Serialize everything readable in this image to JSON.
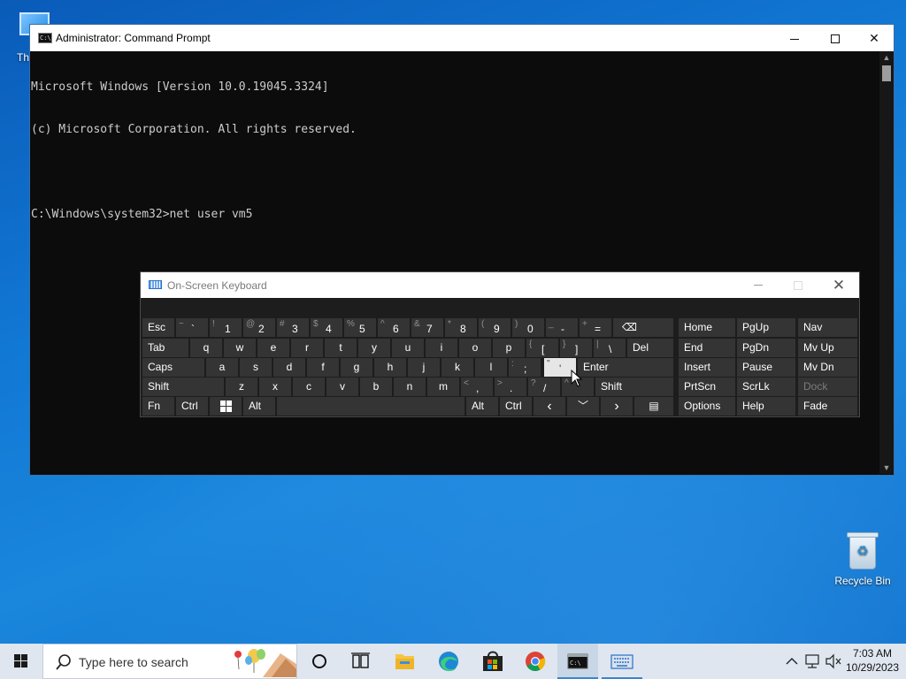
{
  "desktop": {
    "icons": [
      {
        "label": "Th"
      },
      {
        "label": "Recycle Bin"
      }
    ]
  },
  "cmd": {
    "title": "Administrator: Command Prompt",
    "lines": [
      "Microsoft Windows [Version 10.0.19045.3324]",
      "(c) Microsoft Corporation. All rights reserved.",
      "",
      "C:\\Windows\\system32>net user vm5"
    ],
    "close_glyph": "✕"
  },
  "osk": {
    "title": "On-Screen Keyboard",
    "close_glyph": "✕",
    "row1": [
      {
        "label": "Esc"
      },
      {
        "sub": "~",
        "main": "`"
      },
      {
        "sub": "!",
        "main": "1"
      },
      {
        "sub": "@",
        "main": "2"
      },
      {
        "sub": "#",
        "main": "3"
      },
      {
        "sub": "$",
        "main": "4"
      },
      {
        "sub": "%",
        "main": "5"
      },
      {
        "sub": "^",
        "main": "6"
      },
      {
        "sub": "&",
        "main": "7"
      },
      {
        "sub": "*",
        "main": "8"
      },
      {
        "sub": "(",
        "main": "9"
      },
      {
        "sub": ")",
        "main": "0"
      },
      {
        "sub": "_",
        "main": "-"
      },
      {
        "sub": "+",
        "main": "="
      },
      {
        "label": "⌫"
      }
    ],
    "row2": [
      {
        "label": "Tab"
      },
      {
        "label": "q"
      },
      {
        "label": "w"
      },
      {
        "label": "e"
      },
      {
        "label": "r"
      },
      {
        "label": "t"
      },
      {
        "label": "y"
      },
      {
        "label": "u"
      },
      {
        "label": "i"
      },
      {
        "label": "o"
      },
      {
        "label": "p"
      },
      {
        "sub": "{",
        "main": "["
      },
      {
        "sub": "}",
        "main": "]"
      },
      {
        "sub": "|",
        "main": "\\"
      },
      {
        "label": "Del"
      }
    ],
    "row3": [
      {
        "label": "Caps"
      },
      {
        "label": "a"
      },
      {
        "label": "s"
      },
      {
        "label": "d"
      },
      {
        "label": "f"
      },
      {
        "label": "g"
      },
      {
        "label": "h"
      },
      {
        "label": "j"
      },
      {
        "label": "k"
      },
      {
        "label": "l"
      },
      {
        "sub": ":",
        "main": ";"
      },
      {
        "sub": "\"",
        "main": "'"
      },
      {
        "label": "Enter"
      }
    ],
    "row4": [
      {
        "label": "Shift"
      },
      {
        "label": "z"
      },
      {
        "label": "x"
      },
      {
        "label": "c"
      },
      {
        "label": "v"
      },
      {
        "label": "b"
      },
      {
        "label": "n"
      },
      {
        "label": "m"
      },
      {
        "sub": "<",
        "main": ","
      },
      {
        "sub": ">",
        "main": "."
      },
      {
        "sub": "?",
        "main": "/"
      },
      {
        "sub": "^",
        "main": ""
      },
      {
        "label": "Shift"
      }
    ],
    "row5": [
      {
        "label": "Fn"
      },
      {
        "label": "Ctrl"
      },
      {
        "label": ""
      },
      {
        "label": "Alt"
      },
      {
        "label": ""
      },
      {
        "label": "Alt"
      },
      {
        "label": "Ctrl"
      },
      {
        "label": "‹"
      },
      {
        "label": "﹀"
      },
      {
        "label": "›"
      },
      {
        "label": "▤"
      }
    ],
    "nav": [
      [
        "Home",
        "PgUp",
        "Nav"
      ],
      [
        "End",
        "PgDn",
        "Mv Up"
      ],
      [
        "Insert",
        "Pause",
        "Mv Dn"
      ],
      [
        "PrtScn",
        "ScrLk",
        "Dock"
      ],
      [
        "Options",
        "Help",
        "Fade"
      ]
    ]
  },
  "taskbar": {
    "search_placeholder": "Type here to search",
    "clock_time": "7:03 AM",
    "clock_date": "10/29/2023"
  },
  "colors": {
    "desktop_blue": "#1178d4",
    "cmd_background": "#0c0c0c",
    "cmd_text": "#cccccc",
    "osk_background": "#1d1d1d",
    "osk_key": "#343434",
    "osk_key_highlight": "#e6e6e6",
    "taskbar": "#dfe6ef"
  }
}
